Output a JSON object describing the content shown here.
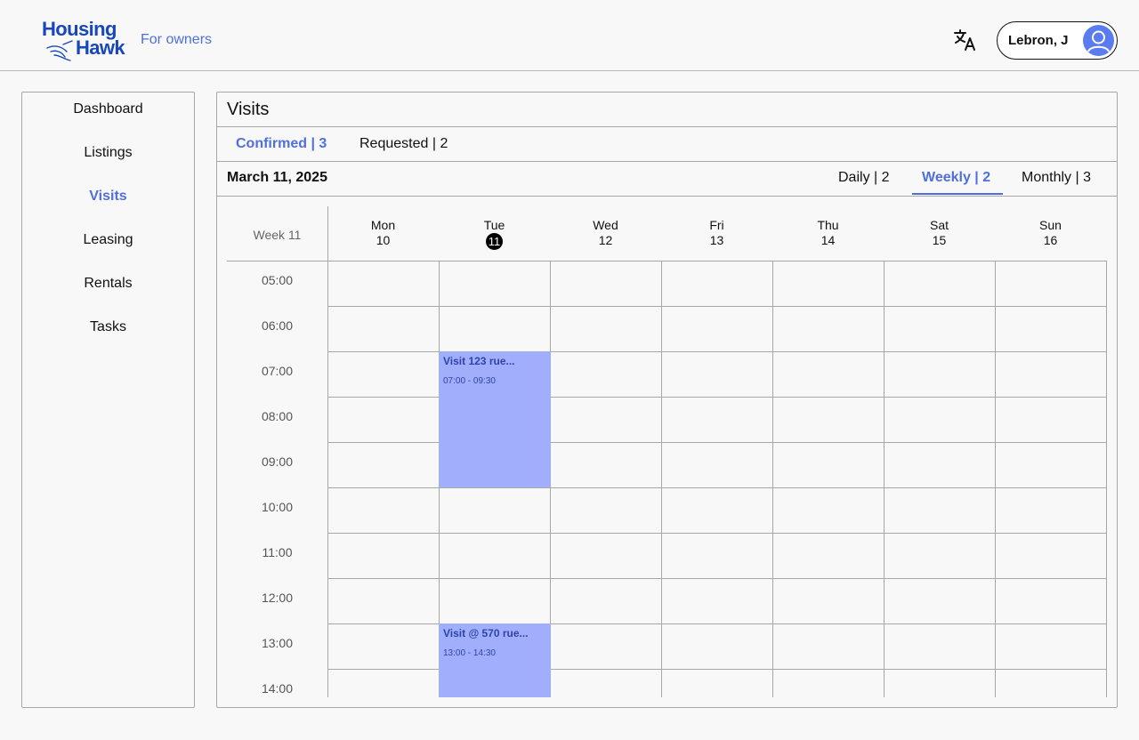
{
  "header": {
    "logo_line1": "Housing",
    "logo_line2": "Hawk",
    "tagline": "For owners",
    "user_name": "Lebron, J"
  },
  "sidebar": {
    "items": [
      {
        "label": "Dashboard"
      },
      {
        "label": "Listings"
      },
      {
        "label": "Visits",
        "active": true
      },
      {
        "label": "Leasing"
      },
      {
        "label": "Rentals"
      },
      {
        "label": "Tasks"
      }
    ]
  },
  "main": {
    "title": "Visits",
    "status_tabs": [
      {
        "label": "Confirmed | 3",
        "active": true
      },
      {
        "label": "Requested | 2"
      }
    ],
    "current_date": "March 11, 2025",
    "view_tabs": [
      {
        "label": "Daily | 2"
      },
      {
        "label": "Weekly | 2",
        "active": true
      },
      {
        "label": "Monthly | 3"
      }
    ]
  },
  "calendar": {
    "week_label": "Week 11",
    "days": [
      {
        "name": "Mon",
        "num": "10"
      },
      {
        "name": "Tue",
        "num": "11",
        "today": true
      },
      {
        "name": "Wed",
        "num": "12"
      },
      {
        "name": "Fri",
        "num": "13"
      },
      {
        "name": "Thu",
        "num": "14"
      },
      {
        "name": "Sat",
        "num": "15"
      },
      {
        "name": "Sun",
        "num": "16"
      }
    ],
    "times": [
      "05:00",
      "06:00",
      "07:00",
      "08:00",
      "09:00",
      "10:00",
      "11:00",
      "12:00",
      "13:00",
      "14:00"
    ],
    "events": [
      {
        "title": "Visit 123 rue...",
        "time": "07:00 - 09:30"
      },
      {
        "title": "Visit @ 570 rue...",
        "time": "13:00 - 14:30"
      }
    ]
  },
  "colors": {
    "accent": "#4f6fdc",
    "event_bg": "#a0aefc",
    "brand": "#1747b8"
  }
}
